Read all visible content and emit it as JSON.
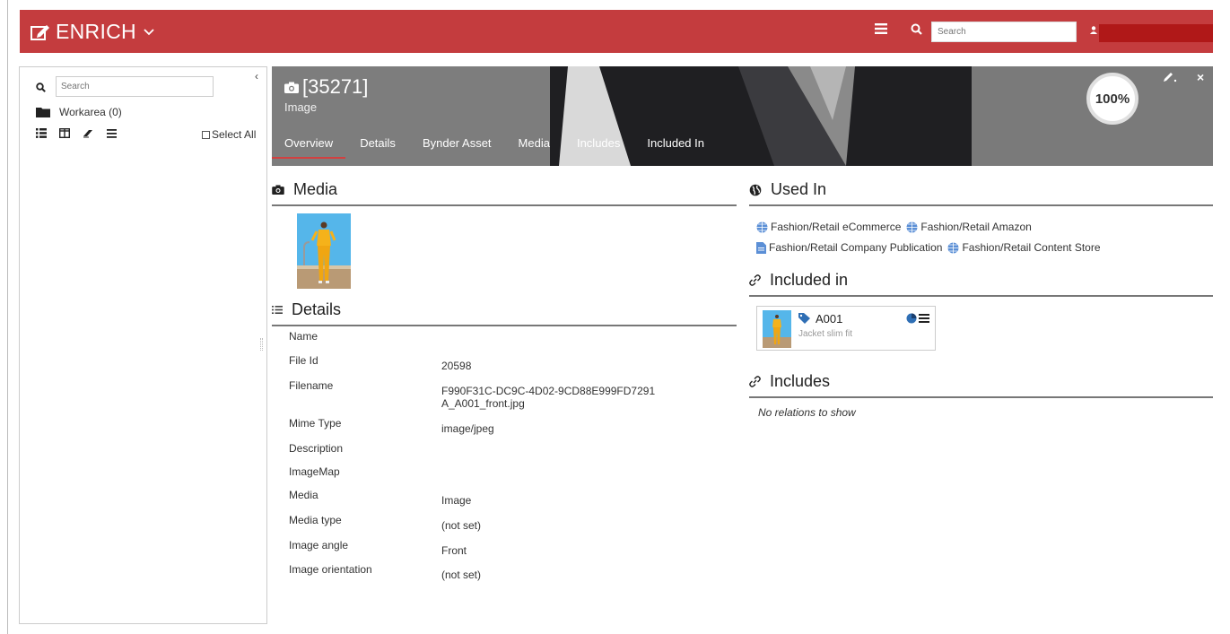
{
  "app": {
    "name": "ENRICH",
    "search_placeholder": "Search"
  },
  "left_panel": {
    "search_placeholder": "Search",
    "workarea_label": "Workarea (0)",
    "select_all_label": "Select All",
    "collapse_glyph": "‹"
  },
  "entity": {
    "id_label": "[35271]",
    "type_label": "Image",
    "completeness": "100%",
    "tabs": [
      "Overview",
      "Details",
      "Bynder Asset",
      "Media",
      "Includes",
      "Included In"
    ],
    "active_tab": "Overview"
  },
  "media_section": {
    "title": "Media"
  },
  "details_section": {
    "title": "Details",
    "rows": [
      {
        "label": "Name",
        "value": ""
      },
      {
        "label": "File Id",
        "value": "20598"
      },
      {
        "label": "Filename",
        "value": "F990F31C-DC9C-4D02-9CD88E999FD7291A_A001_front.jpg"
      },
      {
        "label": "Mime Type",
        "value": "image/jpeg"
      },
      {
        "label": "Description",
        "value": ""
      },
      {
        "label": "ImageMap",
        "value": ""
      },
      {
        "label": "Media",
        "value": "Image"
      },
      {
        "label": "Media type",
        "value": "(not set)"
      },
      {
        "label": "Image angle",
        "value": "Front"
      },
      {
        "label": "Image orientation",
        "value": "(not set)"
      }
    ]
  },
  "used_in_section": {
    "title": "Used In",
    "channels": [
      "Fashion/Retail eCommerce",
      "Fashion/Retail Amazon",
      "Fashion/Retail Company Publication",
      "Fashion/Retail Content Store"
    ]
  },
  "included_in_section": {
    "title": "Included in",
    "items": [
      {
        "code": "A001",
        "description": "Jacket slim fit"
      }
    ]
  },
  "includes_section": {
    "title": "Includes",
    "empty_text": "No relations to show"
  },
  "colors": {
    "brand_red": "#c43c3e",
    "header_gray": "#7c7c7c",
    "active_tab_underline": "#d24040",
    "channel_blue": "#5b8fd6"
  }
}
